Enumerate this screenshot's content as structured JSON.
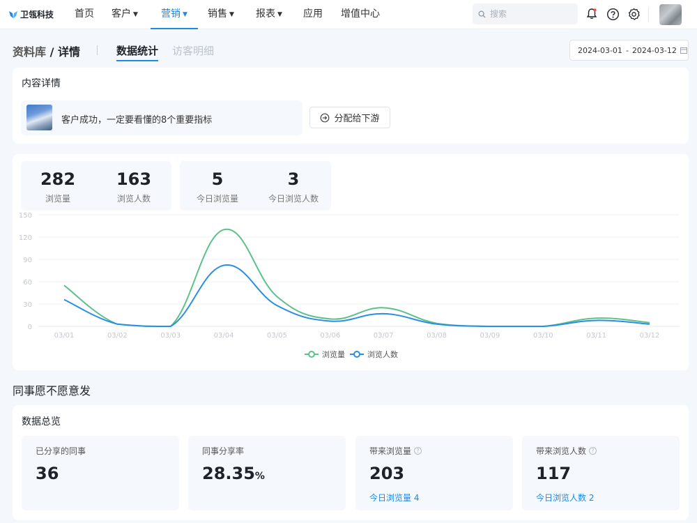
{
  "brand": {
    "name": "卫瓴科技",
    "icon": "butterfly-logo-icon"
  },
  "nav": {
    "items": [
      {
        "label": "首页",
        "dropdown": false
      },
      {
        "label": "客户",
        "dropdown": true
      },
      {
        "label": "营销",
        "dropdown": true,
        "active": true
      },
      {
        "label": "销售",
        "dropdown": true
      },
      {
        "label": "报表",
        "dropdown": true
      },
      {
        "label": "应用",
        "dropdown": false
      },
      {
        "label": "增值中心",
        "dropdown": false
      }
    ],
    "search_placeholder": "搜索",
    "icons": [
      "bell-icon",
      "help-circle-icon",
      "gear-icon"
    ]
  },
  "subheader": {
    "breadcrumb_parent": "资料库",
    "breadcrumb_sep": "/",
    "breadcrumb_current": "详情",
    "tabs": [
      {
        "label": "数据统计",
        "active": true
      },
      {
        "label": "访客明细",
        "active": false
      }
    ],
    "date_start": "2024-03-01",
    "date_sep": "-",
    "date_end": "2024-03-12"
  },
  "content_card": {
    "title": "内容详情",
    "item_title": "客户成功，一定要看懂的8个重要指标",
    "assign_button": "分配给下游"
  },
  "stats": [
    {
      "value": "282",
      "label": "浏览量"
    },
    {
      "value": "163",
      "label": "浏览人数"
    },
    {
      "value": "5",
      "label": "今日浏览量"
    },
    {
      "value": "3",
      "label": "今日浏览人数"
    }
  ],
  "chart_data": {
    "type": "line",
    "smooth": true,
    "x": [
      "03/01",
      "03/02",
      "03/03",
      "03/04",
      "03/05",
      "03/06",
      "03/07",
      "03/08",
      "03/09",
      "03/10",
      "03/11",
      "03/12"
    ],
    "series": [
      {
        "name": "浏览量",
        "color": "#5cc08a",
        "values": [
          55,
          3,
          0,
          130,
          40,
          10,
          25,
          4,
          0,
          0,
          11,
          5
        ]
      },
      {
        "name": "浏览人数",
        "color": "#2a8ee6",
        "values": [
          36,
          3,
          0,
          82,
          28,
          7,
          17,
          3,
          0,
          0,
          8,
          3
        ]
      }
    ],
    "yticks": [
      0,
      30,
      60,
      90,
      120,
      150
    ],
    "ylim": [
      0,
      150
    ],
    "grid": true,
    "legend": "bottom-center"
  },
  "section_heading": "同事愿不愿意发",
  "overview": {
    "title": "数据总览",
    "metrics": [
      {
        "label": "已分享的同事",
        "value": "36",
        "unit": "",
        "help": false,
        "sub": ""
      },
      {
        "label": "同事分享率",
        "value": "28.35",
        "unit": "%",
        "help": false,
        "sub": ""
      },
      {
        "label": "带来浏览量",
        "value": "203",
        "unit": "",
        "help": true,
        "sub": "今日浏览量 4"
      },
      {
        "label": "带来浏览人数",
        "value": "117",
        "unit": "",
        "help": true,
        "sub": "今日浏览人数 2"
      }
    ]
  }
}
